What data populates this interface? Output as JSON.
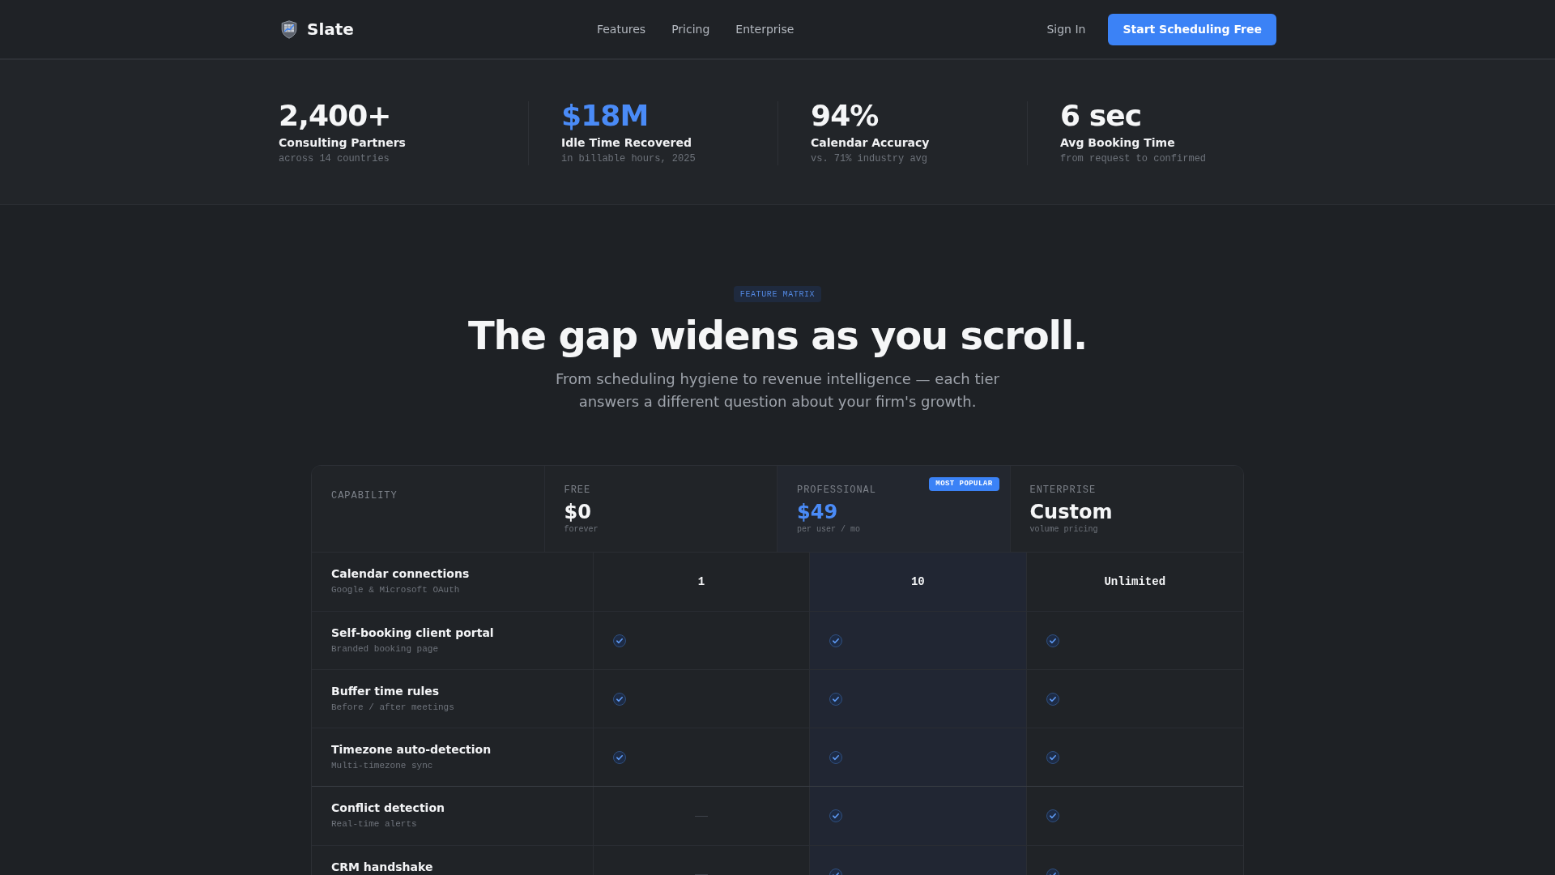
{
  "nav": {
    "brand": "Slate",
    "links": [
      "Features",
      "Pricing",
      "Enterprise"
    ],
    "sign_in": "Sign In",
    "cta": "Start Scheduling Free"
  },
  "stats": [
    {
      "value": "2,400+",
      "label": "Consulting Partners",
      "note": "across 14 countries",
      "accent": false
    },
    {
      "value": "$18M",
      "label": "Idle Time Recovered",
      "note": "in billable hours, 2025",
      "accent": true
    },
    {
      "value": "94%",
      "label": "Calendar Accuracy",
      "note": "vs. 71% industry avg",
      "accent": false
    },
    {
      "value": "6 sec",
      "label": "Avg Booking Time",
      "note": "from request to confirmed",
      "accent": false
    }
  ],
  "feature_matrix": {
    "badge": "FEATURE MATRIX",
    "title": "The gap widens as you scroll.",
    "subtitle": "From scheduling hygiene to revenue intelligence — each tier answers a different question about your firm's growth.",
    "table": {
      "capability_heading": "CAPABILITY",
      "tiers": [
        {
          "name": "FREE",
          "price": "$0",
          "note": "forever",
          "highlighted": false
        },
        {
          "name": "PROFESSIONAL",
          "price": "$49",
          "note": "per user / mo",
          "highlighted": true,
          "badge": "MOST POPULAR"
        },
        {
          "name": "ENTERPRISE",
          "price": "Custom",
          "note": "volume pricing",
          "highlighted": false
        }
      ],
      "groups": [
        {
          "rows": [
            {
              "name": "Calendar connections",
              "note": "Google & Microsoft OAuth",
              "cells": [
                {
                  "kind": "text",
                  "value": "1"
                },
                {
                  "kind": "text",
                  "value": "10"
                },
                {
                  "kind": "text",
                  "value": "Unlimited"
                }
              ]
            },
            {
              "name": "Self-booking client portal",
              "note": "Branded booking page",
              "cells": [
                {
                  "kind": "check"
                },
                {
                  "kind": "check"
                },
                {
                  "kind": "check"
                }
              ]
            },
            {
              "name": "Buffer time rules",
              "note": "Before / after meetings",
              "cells": [
                {
                  "kind": "check"
                },
                {
                  "kind": "check"
                },
                {
                  "kind": "check"
                }
              ]
            },
            {
              "name": "Timezone auto-detection",
              "note": "Multi-timezone sync",
              "cells": [
                {
                  "kind": "check"
                },
                {
                  "kind": "check"
                },
                {
                  "kind": "check"
                }
              ]
            }
          ]
        },
        {
          "rows": [
            {
              "name": "Conflict detection",
              "note": "Real-time alerts",
              "cells": [
                {
                  "kind": "dash"
                },
                {
                  "kind": "check"
                },
                {
                  "kind": "check"
                }
              ]
            },
            {
              "name": "CRM handshake",
              "cells": [
                {
                  "kind": "dash"
                },
                {
                  "kind": "check"
                },
                {
                  "kind": "check"
                }
              ]
            }
          ]
        }
      ]
    }
  }
}
